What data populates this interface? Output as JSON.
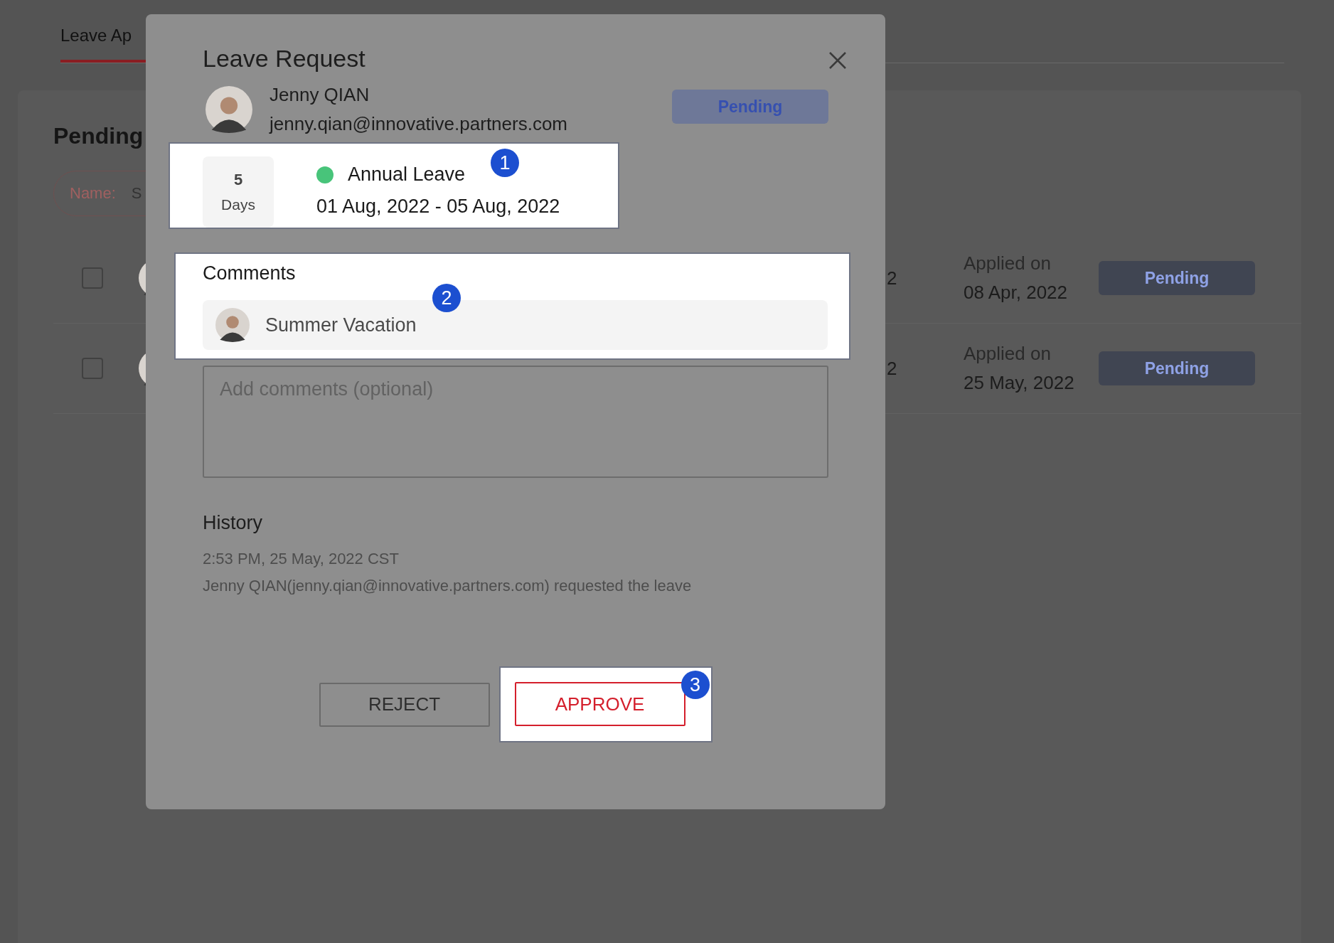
{
  "background": {
    "tab": {
      "label": "Leave Ap",
      "selected": true
    },
    "section_title": "Pending",
    "search": {
      "label": "Name:",
      "value": "S"
    },
    "rows": [
      {
        "checked": false,
        "column_2": "2",
        "applied_label": "Applied on",
        "applied_date": "08 Apr, 2022",
        "status": "Pending"
      },
      {
        "checked": false,
        "column_2": "2",
        "applied_label": "Applied on",
        "applied_date": "25 May, 2022",
        "status": "Pending"
      }
    ]
  },
  "dialog": {
    "title": "Leave Request",
    "employee": {
      "name": "Jenny QIAN",
      "email": "jenny.qian@innovative.partners.com"
    },
    "status": "Pending",
    "leave": {
      "days": "5",
      "days_unit": "Days",
      "type": "Annual Leave",
      "color": "#48c47a",
      "dates": "01 Aug, 2022 - 05 Aug, 2022"
    },
    "comments": {
      "title": "Comments",
      "items": [
        {
          "text": "Summer Vacation"
        }
      ]
    },
    "comment_input": {
      "placeholder": "Add comments (optional)"
    },
    "history": {
      "title": "History",
      "entries": [
        {
          "time": "2:53 PM, 25 May, 2022 CST",
          "text": "Jenny QIAN(jenny.qian@innovative.partners.com) requested the leave"
        }
      ]
    },
    "buttons": [
      {
        "label": "REJECT",
        "kind": "secondary"
      },
      {
        "label": "APPROVE",
        "kind": "primary"
      }
    ]
  },
  "callouts": [
    "1",
    "2",
    "3"
  ]
}
